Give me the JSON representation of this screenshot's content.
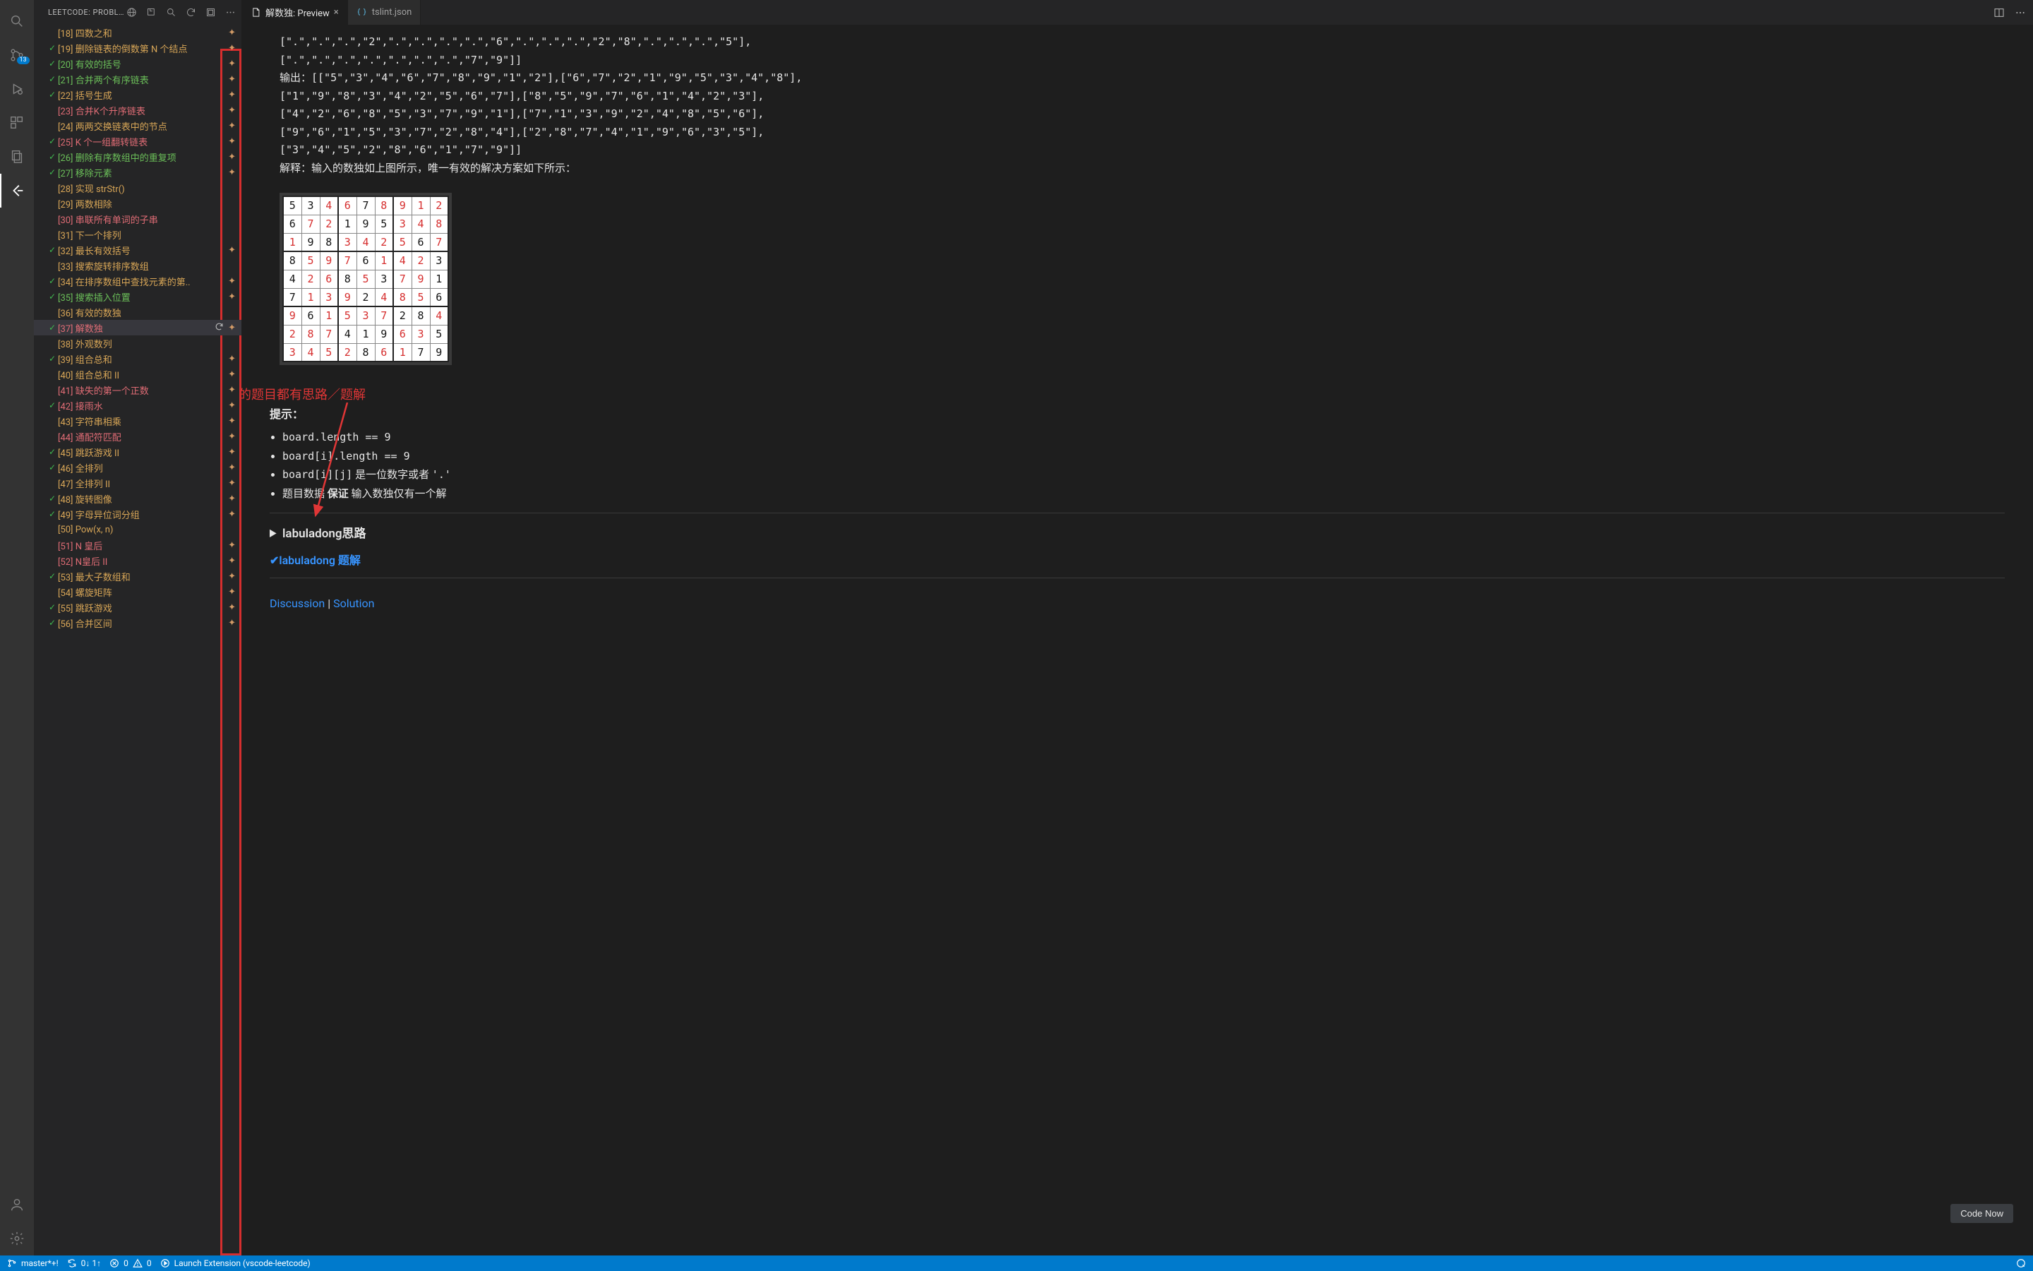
{
  "sidebar": {
    "title": "LEETCODE: PROBLE…",
    "hdr_icons": [
      "globe",
      "external",
      "search",
      "refresh",
      "collapse",
      "more"
    ],
    "problems": [
      {
        "id": "[18]",
        "name": "四数之和",
        "diff": "med",
        "done": false,
        "star": true
      },
      {
        "id": "[19]",
        "name": "删除链表的倒数第 N 个结点",
        "diff": "med",
        "done": true,
        "star": true
      },
      {
        "id": "[20]",
        "name": "有效的括号",
        "diff": "easy",
        "done": true,
        "star": true
      },
      {
        "id": "[21]",
        "name": "合并两个有序链表",
        "diff": "easy",
        "done": true,
        "star": true
      },
      {
        "id": "[22]",
        "name": "括号生成",
        "diff": "med",
        "done": true,
        "star": true
      },
      {
        "id": "[23]",
        "name": "合并K个升序链表",
        "diff": "hard",
        "done": false,
        "star": true
      },
      {
        "id": "[24]",
        "name": "两两交换链表中的节点",
        "diff": "med",
        "done": false,
        "star": true
      },
      {
        "id": "[25]",
        "name": "K 个一组翻转链表",
        "diff": "hard",
        "done": true,
        "star": true
      },
      {
        "id": "[26]",
        "name": "删除有序数组中的重复项",
        "diff": "easy",
        "done": true,
        "star": true
      },
      {
        "id": "[27]",
        "name": "移除元素",
        "diff": "easy",
        "done": true,
        "star": true
      },
      {
        "id": "[28]",
        "name": "实现 strStr()",
        "diff": "med",
        "done": false,
        "star": false
      },
      {
        "id": "[29]",
        "name": "两数相除",
        "diff": "med",
        "done": false,
        "star": false
      },
      {
        "id": "[30]",
        "name": "串联所有单词的子串",
        "diff": "hard",
        "done": false,
        "star": false
      },
      {
        "id": "[31]",
        "name": "下一个排列",
        "diff": "med",
        "done": false,
        "star": false
      },
      {
        "id": "[32]",
        "name": "最长有效括号",
        "diff": "med",
        "done": true,
        "star": true
      },
      {
        "id": "[33]",
        "name": "搜索旋转排序数组",
        "diff": "med",
        "done": false,
        "star": false
      },
      {
        "id": "[34]",
        "name": "在排序数组中查找元素的第..",
        "diff": "med",
        "done": true,
        "star": true
      },
      {
        "id": "[35]",
        "name": "搜索插入位置",
        "diff": "easy",
        "done": true,
        "star": true
      },
      {
        "id": "[36]",
        "name": "有效的数独",
        "diff": "med",
        "done": false,
        "star": false
      },
      {
        "id": "[37]",
        "name": "解数独",
        "diff": "hard",
        "done": true,
        "star": true,
        "selected": true,
        "refresh": true
      },
      {
        "id": "[38]",
        "name": "外观数列",
        "diff": "med",
        "done": false,
        "star": false
      },
      {
        "id": "[39]",
        "name": "组合总和",
        "diff": "med",
        "done": true,
        "star": true
      },
      {
        "id": "[40]",
        "name": "组合总和 II",
        "diff": "med",
        "done": false,
        "star": true
      },
      {
        "id": "[41]",
        "name": "缺失的第一个正数",
        "diff": "hard",
        "done": false,
        "star": true
      },
      {
        "id": "[42]",
        "name": "接雨水",
        "diff": "hard",
        "done": true,
        "star": true
      },
      {
        "id": "[43]",
        "name": "字符串相乘",
        "diff": "med",
        "done": false,
        "star": true
      },
      {
        "id": "[44]",
        "name": "通配符匹配",
        "diff": "hard",
        "done": false,
        "star": true
      },
      {
        "id": "[45]",
        "name": "跳跃游戏 II",
        "diff": "med",
        "done": true,
        "star": true
      },
      {
        "id": "[46]",
        "name": "全排列",
        "diff": "med",
        "done": true,
        "star": true
      },
      {
        "id": "[47]",
        "name": "全排列 II",
        "diff": "med",
        "done": false,
        "star": true
      },
      {
        "id": "[48]",
        "name": "旋转图像",
        "diff": "med",
        "done": true,
        "star": true
      },
      {
        "id": "[49]",
        "name": "字母异位词分组",
        "diff": "med",
        "done": true,
        "star": true
      },
      {
        "id": "[50]",
        "name": "Pow(x, n)",
        "diff": "med",
        "done": false,
        "star": false
      },
      {
        "id": "[51]",
        "name": "N 皇后",
        "diff": "hard",
        "done": false,
        "star": true
      },
      {
        "id": "[52]",
        "name": "N皇后 II",
        "diff": "hard",
        "done": false,
        "star": true
      },
      {
        "id": "[53]",
        "name": "最大子数组和",
        "diff": "med",
        "done": true,
        "star": true
      },
      {
        "id": "[54]",
        "name": "螺旋矩阵",
        "diff": "med",
        "done": false,
        "star": true
      },
      {
        "id": "[55]",
        "name": "跳跃游戏",
        "diff": "med",
        "done": true,
        "star": true
      },
      {
        "id": "[56]",
        "name": "合并区间",
        "diff": "med",
        "done": true,
        "star": true
      }
    ]
  },
  "tabs": [
    {
      "label": "解数独: Preview",
      "icon": "file",
      "active": true,
      "closeable": true
    },
    {
      "label": "tslint.json",
      "icon": "json",
      "active": false,
      "closeable": false
    }
  ],
  "preview": {
    "code_lines": [
      "[\".\",\".\",\".\",\"2\",\".\",\".\",\".\",\".\",\"6\",\".\",\".\",\".\",\"2\",\"8\",\".\",\".\",\".\",\"5\"],",
      "[\".\",\".\",\".\",\".\",\".\",\".\",\".\",\"7\",\"9\"]]",
      "输出：[[\"5\",\"3\",\"4\",\"6\",\"7\",\"8\",\"9\",\"1\",\"2\"],[\"6\",\"7\",\"2\",\"1\",\"9\",\"5\",\"3\",\"4\",\"8\"],",
      "[\"1\",\"9\",\"8\",\"3\",\"4\",\"2\",\"5\",\"6\",\"7\"],[\"8\",\"5\",\"9\",\"7\",\"6\",\"1\",\"4\",\"2\",\"3\"],",
      "[\"4\",\"2\",\"6\",\"8\",\"5\",\"3\",\"7\",\"9\",\"1\"],[\"7\",\"1\",\"3\",\"9\",\"2\",\"4\",\"8\",\"5\",\"6\"],",
      "[\"9\",\"6\",\"1\",\"5\",\"3\",\"7\",\"2\",\"8\",\"4\"],[\"2\",\"8\",\"7\",\"4\",\"1\",\"9\",\"6\",\"3\",\"5\"],",
      "[\"3\",\"4\",\"5\",\"2\",\"8\",\"6\",\"1\",\"7\",\"9\"]]",
      "解释：输入的数独如上图所示，唯一有效的解决方案如下所示："
    ],
    "sudoku": {
      "given": [
        [
          5,
          3,
          0,
          0,
          7,
          0,
          0,
          0,
          0
        ],
        [
          6,
          0,
          0,
          1,
          9,
          5,
          0,
          0,
          0
        ],
        [
          0,
          9,
          8,
          0,
          0,
          0,
          0,
          6,
          0
        ],
        [
          8,
          0,
          0,
          0,
          6,
          0,
          0,
          0,
          3
        ],
        [
          4,
          0,
          0,
          8,
          0,
          3,
          0,
          0,
          1
        ],
        [
          7,
          0,
          0,
          0,
          2,
          0,
          0,
          0,
          6
        ],
        [
          0,
          6,
          0,
          0,
          0,
          0,
          2,
          8,
          0
        ],
        [
          0,
          0,
          0,
          4,
          1,
          9,
          0,
          0,
          5
        ],
        [
          0,
          0,
          0,
          0,
          8,
          0,
          0,
          7,
          9
        ]
      ],
      "solution": [
        [
          5,
          3,
          4,
          6,
          7,
          8,
          9,
          1,
          2
        ],
        [
          6,
          7,
          2,
          1,
          9,
          5,
          3,
          4,
          8
        ],
        [
          1,
          9,
          8,
          3,
          4,
          2,
          5,
          6,
          7
        ],
        [
          8,
          5,
          9,
          7,
          6,
          1,
          4,
          2,
          3
        ],
        [
          4,
          2,
          6,
          8,
          5,
          3,
          7,
          9,
          1
        ],
        [
          7,
          1,
          3,
          9,
          2,
          4,
          8,
          5,
          6
        ],
        [
          9,
          6,
          1,
          5,
          3,
          7,
          2,
          8,
          4
        ],
        [
          2,
          8,
          7,
          4,
          1,
          9,
          6,
          3,
          5
        ],
        [
          3,
          4,
          5,
          2,
          8,
          6,
          1,
          7,
          9
        ]
      ]
    },
    "annotation": "标星的题目都有思路／题解",
    "hint_title": "提示：",
    "hints": [
      "board.length == 9",
      "board[i].length == 9",
      "board[i][j] 是一位数字或者 '.'",
      "题目数据 保证 输入数独仅有一个解"
    ],
    "think_label": "labuladong思路",
    "solution_link": "✔labuladong 题解",
    "discussion": "Discussion",
    "solution": "Solution",
    "code_now": "Code Now"
  },
  "status": {
    "branch": "master*+!",
    "sync": "0↓ 1↑",
    "errors": "0",
    "warnings": "0",
    "task": "Launch Extension (vscode-leetcode)"
  },
  "activity_badge": "13"
}
